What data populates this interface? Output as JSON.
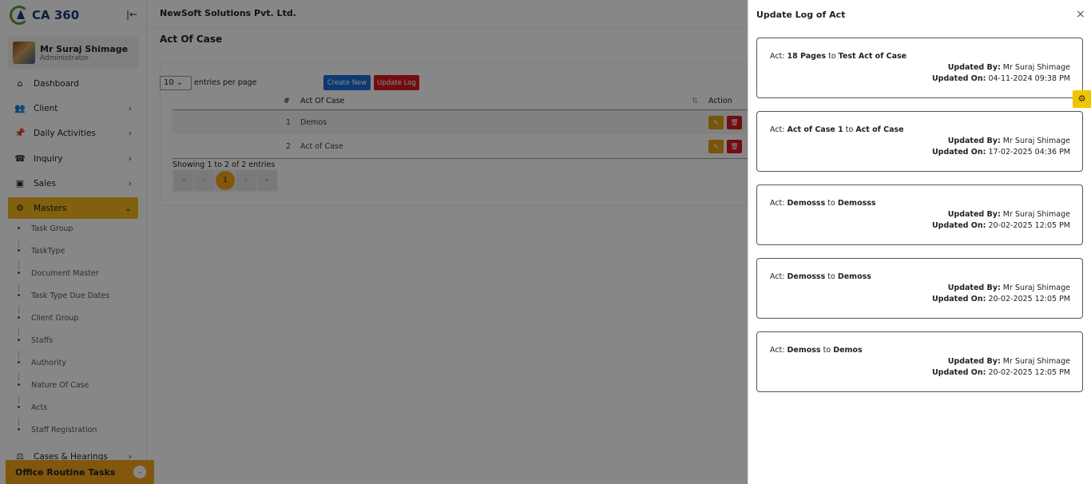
{
  "app": {
    "logo_text": "CA 360",
    "company": "NewSoft Solutions Pvt. Ltd."
  },
  "user": {
    "name": "Mr Suraj Shimage",
    "role": "Administrator"
  },
  "nav": [
    {
      "label": "Dashboard",
      "icon": "home-icon"
    },
    {
      "label": "Client",
      "icon": "users-icon"
    },
    {
      "label": "Daily Activities",
      "icon": "pin-icon"
    },
    {
      "label": "Inquiry",
      "icon": "phone-icon"
    },
    {
      "label": "Sales",
      "icon": "money-icon"
    },
    {
      "label": "Masters",
      "icon": "gears-icon"
    }
  ],
  "masters_sub": [
    "Task Group",
    "TaskType",
    "Document Master",
    "Task Type Due Dates",
    "Client Group",
    "Staffs",
    "Authority",
    "Nature Of Case",
    "Acts",
    "Staff Registration"
  ],
  "nav_bottom": {
    "label": "Cases & Hearings"
  },
  "office_routine": "Office Routine Tasks",
  "page": {
    "title": "Act Of Case",
    "per_page_value": "10",
    "per_page_label": "entries per page",
    "create_new": "Create New",
    "update_log": "Update Log",
    "col_num": "#",
    "col_name": "Act Of Case",
    "col_action": "Action",
    "rows": [
      {
        "num": "1",
        "name": "Demos"
      },
      {
        "num": "2",
        "name": "Act of Case"
      }
    ],
    "showing": "Showing 1 to 2 of 2 entries",
    "pager": [
      "«",
      "‹",
      "1",
      "›",
      "»"
    ]
  },
  "panel": {
    "title": "Update Log of Act",
    "close": "×",
    "act_label": "Act:",
    "to": "to",
    "updated_by_label": "Updated By:",
    "updated_on_label": "Updated On:",
    "logs": [
      {
        "from": "18 Pages",
        "to": "Test Act of Case",
        "by": "Mr Suraj Shimage",
        "on": "04-11-2024 09:38 PM"
      },
      {
        "from": "Act of Case 1",
        "to": "Act of Case",
        "by": "Mr Suraj Shimage",
        "on": "17-02-2025 04:36 PM"
      },
      {
        "from": "Demosss",
        "to": "Demosss",
        "by": "Mr Suraj Shimage",
        "on": "20-02-2025 12:05 PM"
      },
      {
        "from": "Demosss",
        "to": "Demoss",
        "by": "Mr Suraj Shimage",
        "on": "20-02-2025 12:05 PM"
      },
      {
        "from": "Demoss",
        "to": "Demos",
        "by": "Mr Suraj Shimage",
        "on": "20-02-2025 12:05 PM"
      }
    ]
  },
  "colors": {
    "accent": "#f3b51d",
    "primary_btn": "#1a6fd8",
    "danger_btn": "#d61c22",
    "edit_btn": "#e0a112"
  }
}
